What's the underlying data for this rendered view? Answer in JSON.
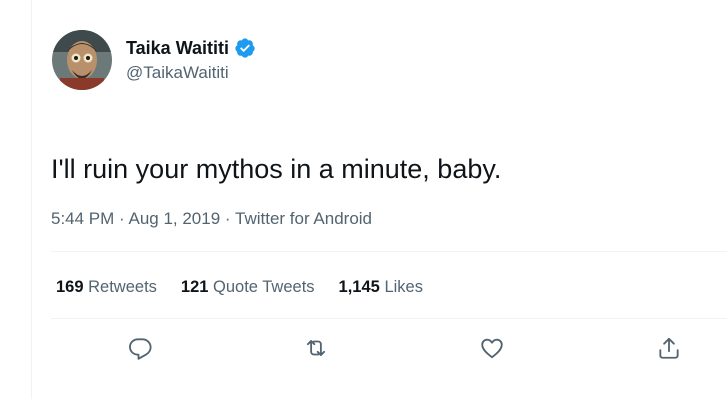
{
  "author": {
    "display_name": "Taika Waititi",
    "handle": "@TaikaWaititi",
    "verified": true,
    "avatar_icon": "profile-photo"
  },
  "tweet": {
    "text": "I'll ruin your mythos in a minute, baby.",
    "time": "5:44 PM",
    "date": "Aug 1, 2019",
    "source": "Twitter for Android",
    "separator": " · "
  },
  "stats": {
    "retweets": {
      "count": "169",
      "label": "Retweets"
    },
    "quote_tweets": {
      "count": "121",
      "label": "Quote Tweets"
    },
    "likes": {
      "count": "1,145",
      "label": "Likes"
    }
  },
  "actions": [
    {
      "icon": "reply-icon"
    },
    {
      "icon": "retweet-icon"
    },
    {
      "icon": "like-icon"
    },
    {
      "icon": "share-icon"
    }
  ],
  "colors": {
    "text_primary": "#0f1419",
    "text_secondary": "#536471",
    "verified_badge": "#1d9bf0",
    "divider": "#eff3f4"
  }
}
